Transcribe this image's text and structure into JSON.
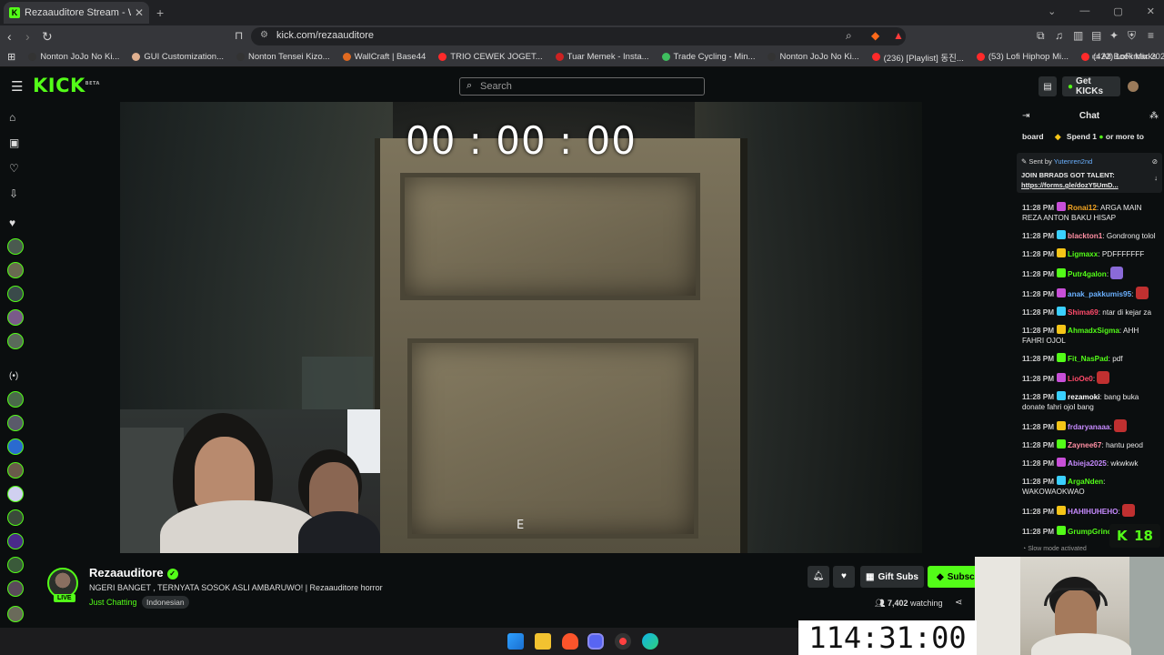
{
  "browser": {
    "tab_title": "Rezaauditore Stream - Watch",
    "url": "kick.com/rezaauditore",
    "bookmarks": [
      {
        "label": "Nonton JoJo No Ki..."
      },
      {
        "label": "GUI Customization..."
      },
      {
        "label": "Nonton Tensei Kizo..."
      },
      {
        "label": "WallCraft | Base44"
      },
      {
        "label": "TRIO CEWEK JOGET..."
      },
      {
        "label": "Tuar Memek - Insta..."
      },
      {
        "label": "Trade Cycling - Min..."
      },
      {
        "label": "Nonton JoJo No Ki..."
      },
      {
        "label": "(236) [Playlist] 동진..."
      },
      {
        "label": "(53) Lofi Hiphop Mi..."
      },
      {
        "label": "(422) LoFi Mix 2022..."
      }
    ],
    "all_bookmarks": "All Bookmarks",
    "colors": {
      "tabbar": "#202124",
      "toolbar": "#35363a"
    }
  },
  "kick": {
    "logo": "KICK",
    "logo_badge": "BETA",
    "search_placeholder": "Search",
    "get_kicks": "Get KICKs",
    "accent": "#53fc18"
  },
  "player": {
    "overlay_timer": "00 : 00 : 00",
    "key_hint": "E"
  },
  "stream": {
    "channel": "Rezaauditore",
    "live_badge": "LIVE",
    "title": "NGERI BANGET , TERNYATA SOSOK ASLI AMBARUWO! | Rezaauditore horror",
    "category": "Just Chatting",
    "tag": "Indonesian",
    "gift_subs": "Gift Subs",
    "subscribe": "Subscribe",
    "viewers": "7,402",
    "watching": "watching"
  },
  "chat": {
    "title": "Chat",
    "leaderboard": "board",
    "leaderboard_promo": "Spend 1",
    "leaderboard_promo_tail": "or more to",
    "pinned_sent_by": "Sent by",
    "pinned_user": "Yutenren2nd",
    "pinned_text": "JOIN BRRADS GOT TALENT:",
    "pinned_link": "https://forms.gle/dozY5UmD...",
    "messages": [
      {
        "time": "11:28 PM",
        "user": "Ronai12",
        "color": "#f5a623",
        "text": "ARGA MAIN REZA ANTON BAKU HISAP"
      },
      {
        "time": "11:28 PM",
        "user": "blackton1",
        "color": "#ff8fa3",
        "text": "Gondrong tolol"
      },
      {
        "time": "11:28 PM",
        "user": "Ligmaxx",
        "color": "#53fc18",
        "text": "PDFFFFFFF"
      },
      {
        "time": "11:28 PM",
        "user": "Putr4galon",
        "color": "#53fc18",
        "text": ""
      },
      {
        "time": "11:28 PM",
        "user": "anak_pakkumis95",
        "color": "#6ab0ff",
        "text": ""
      },
      {
        "time": "11:28 PM",
        "user": "Shima69",
        "color": "#ff4a6a",
        "text": "ntar di kejar za"
      },
      {
        "time": "11:28 PM",
        "user": "AhmadxSigma",
        "color": "#53fc18",
        "text": "AHH FAHRI OJOL"
      },
      {
        "time": "11:28 PM",
        "user": "Fit_NasPad",
        "color": "#53fc18",
        "text": "pdf"
      },
      {
        "time": "11:28 PM",
        "user": "LioOe0",
        "color": "#ff4a6a",
        "text": ""
      },
      {
        "time": "11:28 PM",
        "user": "rezamoki",
        "color": "#ffffff",
        "text": "bang buka donate fahri ojol bang"
      },
      {
        "time": "11:28 PM",
        "user": "frdaryanaaa",
        "color": "#c78bff",
        "text": ""
      },
      {
        "time": "11:28 PM",
        "user": "Zaynee67",
        "color": "#ff8fa3",
        "text": "hantu peod"
      },
      {
        "time": "11:28 PM",
        "user": "Abieja2025",
        "color": "#c78bff",
        "text": "wkwkwk"
      },
      {
        "time": "11:28 PM",
        "user": "ArgaNden",
        "color": "#53fc18",
        "text": "WAKOWAOKWAO"
      },
      {
        "time": "11:28 PM",
        "user": "HAHIHUHEHO",
        "color": "#c78bff",
        "text": ""
      },
      {
        "time": "11:28 PM",
        "user": "GrumpGrinch",
        "color": "#53fc18",
        "text": ""
      }
    ],
    "slow_mode": "Slow mode activated",
    "counter": "18"
  },
  "overlay_clock": "114:31:00"
}
